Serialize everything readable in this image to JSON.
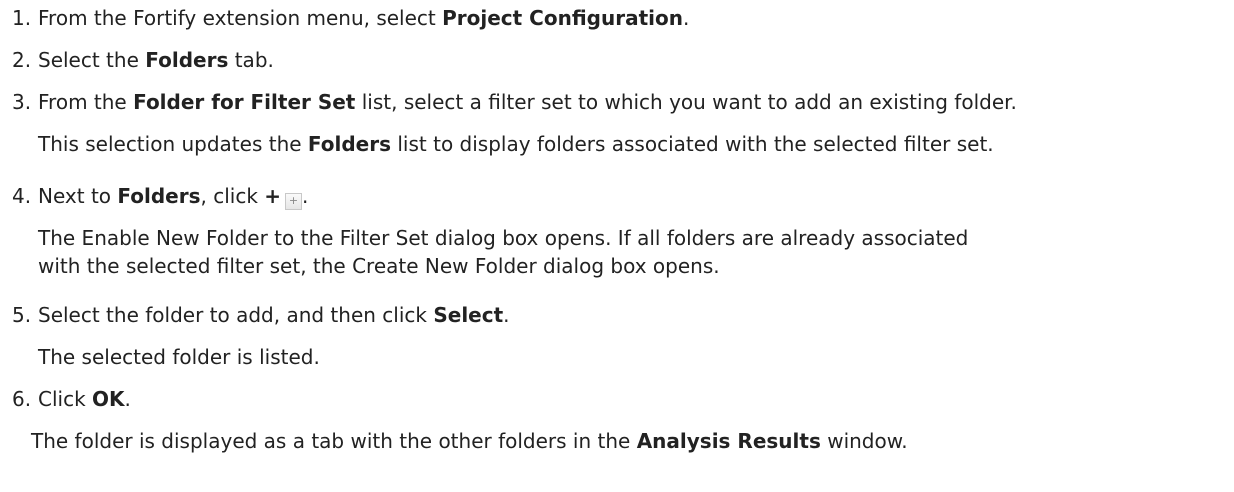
{
  "steps": [
    {
      "num": "1.",
      "pre": "From the Fortify extension menu, select ",
      "bold": "Project Configuration",
      "post": "."
    },
    {
      "num": "2.",
      "pre": "Select the ",
      "bold": "Folders",
      "post": " tab."
    },
    {
      "num": "3.",
      "pre": "From the ",
      "bold": "Folder for Filter Set",
      "post": " list, select a filter set to which you want to add an existing folder.",
      "sub_pre": "This selection updates the ",
      "sub_bold": "Folders",
      "sub_post": " list to display folders associated with the selected filter set."
    },
    {
      "num": "4.",
      "pre": "Next to ",
      "bold": "Folders",
      "post": ", click ",
      "bold2": "+",
      "end": ".",
      "sub_line1": "The Enable New Folder to the Filter Set dialog box opens. If all folders are already associated",
      "sub_line2": "with the selected filter set, the Create New Folder dialog box opens."
    },
    {
      "num": "5.",
      "pre": "Select the folder to add, and then click ",
      "bold": "Select",
      "post": ".",
      "sub": "The selected folder is listed."
    },
    {
      "num": "6.",
      "pre": "Click ",
      "bold": "OK",
      "post": "."
    }
  ],
  "final": {
    "pre": "The folder is displayed as a tab with the other folders in the ",
    "bold": "Analysis Results",
    "post": " window."
  },
  "icon_glyph": "+"
}
